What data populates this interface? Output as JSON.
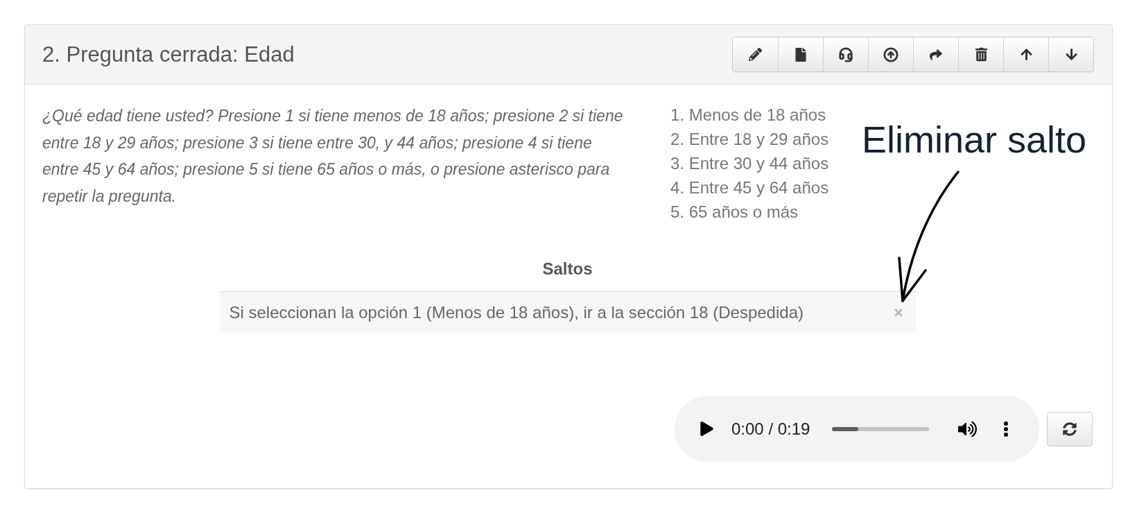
{
  "panel": {
    "title": "2. Pregunta cerrada: Edad",
    "toolbar": [
      {
        "kind": "edit"
      },
      {
        "kind": "file"
      },
      {
        "kind": "audio"
      },
      {
        "kind": "upload"
      },
      {
        "kind": "forward"
      },
      {
        "kind": "delete"
      },
      {
        "kind": "move_up"
      },
      {
        "kind": "move_down"
      }
    ]
  },
  "question": {
    "prompt": "¿Qué edad tiene usted? Presione 1 si tiene menos de 18 años; presione 2 si tiene entre 18 y 29 años; presione 3 si tiene entre 30, y 44 años; presione 4 si tiene entre 45 y 64 años; presione 5 si tiene 65 años o más, o presione asterisco para repetir la pregunta.",
    "options": [
      "1. Menos de 18 años",
      "2. Entre 18 y 29 años",
      "3. Entre 30 y 44 años",
      "4. Entre 45 y 64 años",
      "5. 65 años o más"
    ]
  },
  "jumps": {
    "heading": "Saltos",
    "rows": [
      {
        "text": "Si seleccionan la opción 1 (Menos de 18 años), ir a la sección 18 (Despedida)"
      }
    ]
  },
  "audio": {
    "time": "0:00 / 0:19",
    "level": 0.27
  },
  "annotation": {
    "text": "Eliminar salto"
  }
}
